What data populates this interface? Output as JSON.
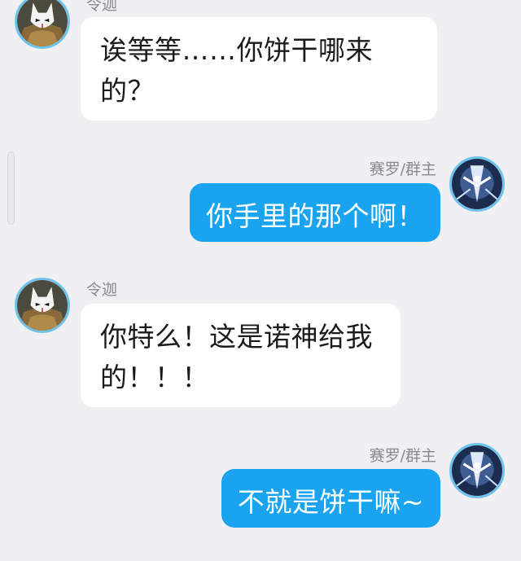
{
  "messages": [
    {
      "sender": "令迦",
      "direction": "in",
      "text": "诶等等……你饼干哪来的？"
    },
    {
      "sender": "赛罗/群主",
      "direction": "out",
      "text": "你手里的那个啊！"
    },
    {
      "sender": "令迦",
      "direction": "in",
      "text": "你特么！这是诺神给我的！！！"
    },
    {
      "sender": "赛罗/群主",
      "direction": "out",
      "text": "不就是饼干嘛~"
    }
  ],
  "colors": {
    "background": "#f0f0f2",
    "incoming_bubble": "#ffffff",
    "outgoing_bubble": "#1aa4f0",
    "avatar_border": "#6fc3ea",
    "sender_name": "#8a8a8e"
  },
  "icons": {
    "lingjia_avatar": "masked-figure-avatar-icon",
    "sailuo_avatar": "light-figure-avatar-icon"
  }
}
